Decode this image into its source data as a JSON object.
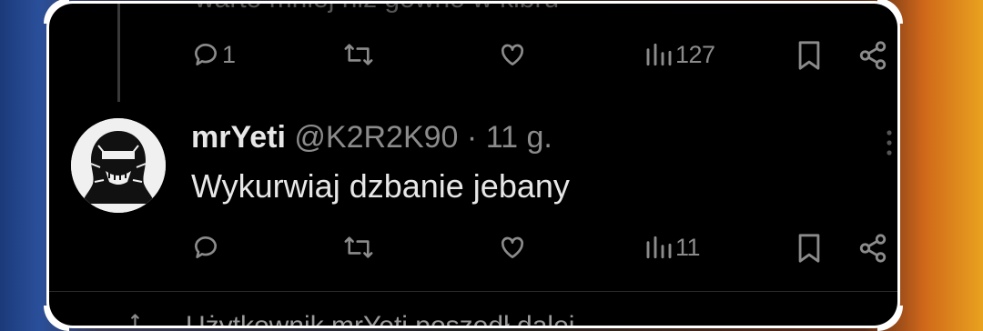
{
  "top_tweet": {
    "partial_text": "warto mniej niż gówno w kibru",
    "reply_count": "1",
    "views": "127"
  },
  "reply": {
    "name": "mrYeti",
    "handle": "@K2R2K90",
    "separator": "·",
    "time": "11 g.",
    "text": "Wykurwiaj dzbanie jebany",
    "views": "11"
  },
  "footer": {
    "partial_text": "Użytkownik mrYeti poszedł dalej"
  },
  "icons": [
    "reply-icon",
    "retweet-icon",
    "like-icon",
    "views-icon",
    "bookmark-icon",
    "share-icon",
    "more-icon"
  ]
}
